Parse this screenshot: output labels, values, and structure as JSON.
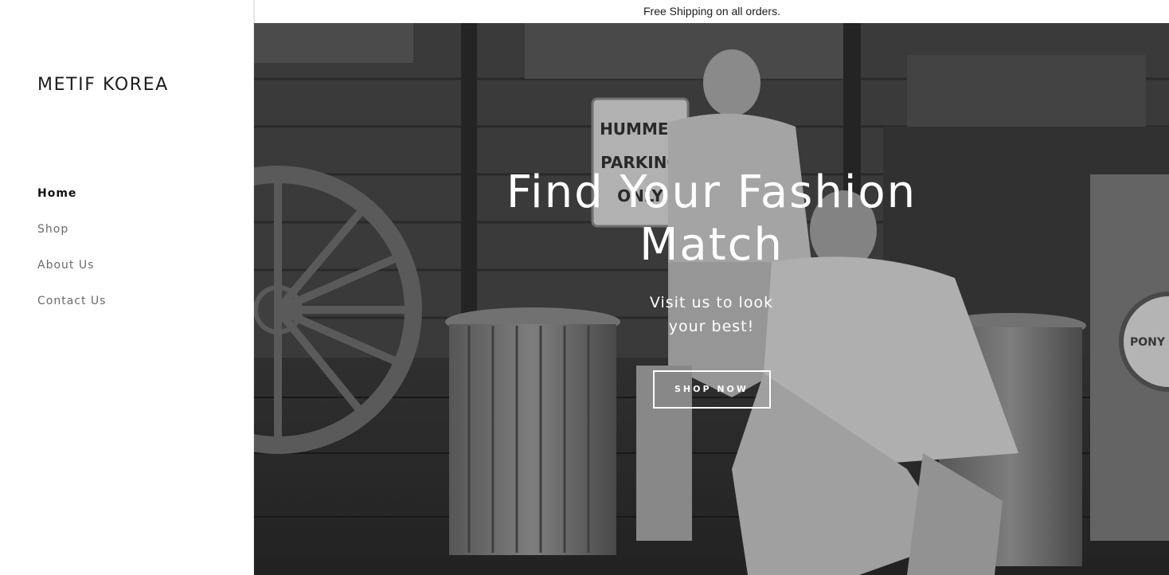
{
  "brand": {
    "name": "METIF KOREA"
  },
  "nav": {
    "items": [
      {
        "label": "Home",
        "active": true
      },
      {
        "label": "Shop",
        "active": false
      },
      {
        "label": "About Us",
        "active": false
      },
      {
        "label": "Contact Us",
        "active": false
      }
    ]
  },
  "announcement": {
    "text": "Free Shipping on all orders."
  },
  "hero": {
    "title": "Find Your Fashion Match",
    "subtitle": "Visit us to look your best!",
    "button_label": "SHOP NOW"
  },
  "signage": {
    "parking_sign": "HUMMER PARKING ONLY",
    "round_sign": "PONY SERVICE"
  },
  "colors": {
    "text_primary": "#111111",
    "text_muted": "#6b6b6b",
    "hero_overlay": "#000000"
  }
}
